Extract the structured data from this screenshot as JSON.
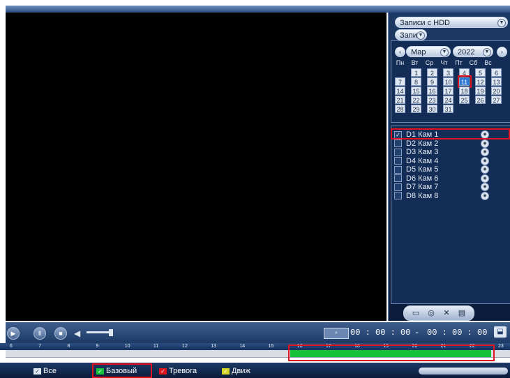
{
  "source_select": {
    "label": "Записи с HDD",
    "arrow": "chevron-down-icon"
  },
  "type_select": {
    "label": "Запис"
  },
  "calendar": {
    "prev_icon": "‹",
    "month": "Мар",
    "year": "2022",
    "next_icon": "›",
    "weekdays": [
      "Пн",
      "Вт",
      "Ср",
      "Чт",
      "Пт",
      "Сб",
      "Вс"
    ],
    "days": [
      "1",
      "2",
      "3",
      "4",
      "5",
      "6",
      "7",
      "8",
      "9",
      "10",
      "11",
      "12",
      "13",
      "14",
      "15",
      "16",
      "17",
      "18",
      "19",
      "20",
      "21",
      "22",
      "23",
      "24",
      "25",
      "26",
      "27",
      "28",
      "29",
      "30",
      "31"
    ],
    "selected_day": "11"
  },
  "cameras": [
    {
      "label": "D1 Кам 1",
      "checked": true
    },
    {
      "label": "D2 Кам 2",
      "checked": false
    },
    {
      "label": "D3 Кам 3",
      "checked": false
    },
    {
      "label": "D4 Кам 4",
      "checked": false
    },
    {
      "label": "D5 Кам 5",
      "checked": false
    },
    {
      "label": "D6 Кам 6",
      "checked": false
    },
    {
      "label": "D7 Кам 7",
      "checked": false
    },
    {
      "label": "D8 Кам 8",
      "checked": false
    }
  ],
  "controls": {
    "start_time": "00 : 00 : 00",
    "separator": "-",
    "end_time": "00 : 00 : 00"
  },
  "timeline_ticks": [
    "6",
    "7",
    "8",
    "9",
    "10",
    "11",
    "12",
    "13",
    "14",
    "15",
    "16",
    "17",
    "18",
    "19",
    "20",
    "21",
    "22",
    "23"
  ],
  "legend": {
    "all": "Все",
    "basic": "Базовый",
    "alarm": "Тревога",
    "motion": "Движ"
  },
  "colors": {
    "basic": "#16c23a",
    "alarm": "#e0141e",
    "motion": "#d6d62a",
    "highlight": "#e0141e"
  }
}
